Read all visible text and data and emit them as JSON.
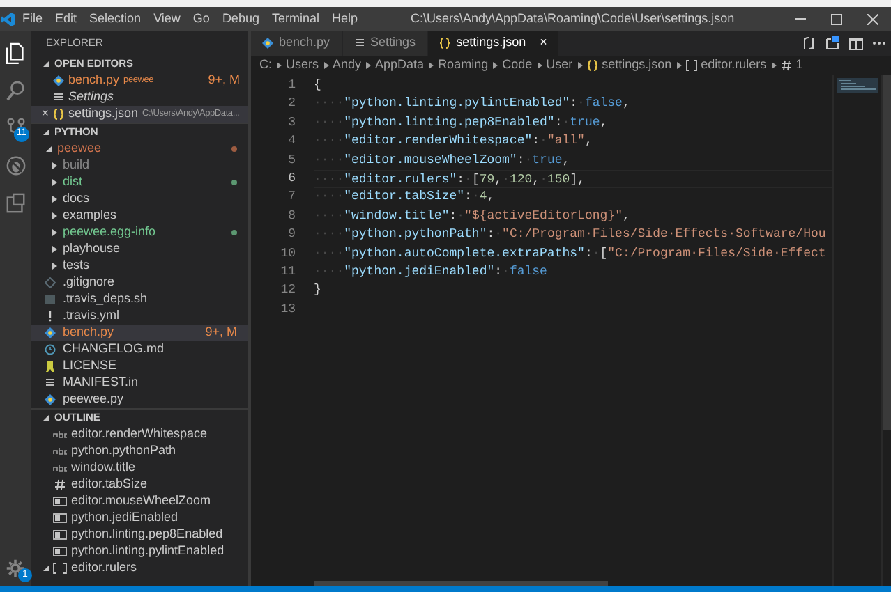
{
  "title_bar": {
    "menu": [
      "File",
      "Edit",
      "Selection",
      "View",
      "Go",
      "Debug",
      "Terminal",
      "Help"
    ],
    "title": "C:\\Users\\Andy\\AppData\\Roaming\\Code\\User\\settings.json"
  },
  "activity_bar": [
    {
      "kind": "files",
      "selected": true
    },
    {
      "kind": "search",
      "selected": false
    },
    {
      "kind": "source-control",
      "selected": false,
      "badge": "11"
    },
    {
      "kind": "debug",
      "selected": false
    },
    {
      "kind": "extensions",
      "selected": false
    }
  ],
  "manage": {
    "badge": "1"
  },
  "sidebar": {
    "title": "EXPLORER",
    "open_editors": {
      "title": "OPEN EDITORS",
      "expanded": true,
      "items": [
        {
          "label": "bench.py",
          "kind": "python",
          "description": "peewee",
          "status": "9+, M",
          "color": "#e8894a",
          "preview": false,
          "selected": false
        },
        {
          "label": "Settings",
          "kind": "list",
          "preview": true,
          "color": "#cccccc",
          "selected": false
        },
        {
          "label": "settings.json",
          "kind": "json",
          "description": "C:\\Users\\Andy\\AppData...",
          "close": "×",
          "color": "#cccccc",
          "preview": false,
          "selected": true
        }
      ]
    },
    "python": {
      "title": "PYTHON",
      "expanded": true,
      "tree": [
        {
          "label": "peewee",
          "kind": "folder",
          "expanded": true,
          "color": "#d0734d",
          "dot": true,
          "selected": false,
          "children": [
            {
              "label": "build",
              "kind": "folder",
              "expanded": false,
              "color": "#8b8b8b",
              "dot": false,
              "selected": false
            },
            {
              "label": "dist",
              "kind": "folder",
              "expanded": false,
              "color": "#73c991",
              "dot": true,
              "selected": false
            },
            {
              "label": "docs",
              "kind": "folder",
              "expanded": false,
              "color": "#cccccc",
              "dot": false,
              "selected": false
            },
            {
              "label": "examples",
              "kind": "folder",
              "expanded": false,
              "color": "#cccccc",
              "dot": false,
              "selected": false
            },
            {
              "label": "peewee.egg-info",
              "kind": "folder",
              "expanded": false,
              "color": "#73c991",
              "dot": true,
              "selected": false
            },
            {
              "label": "playhouse",
              "kind": "folder",
              "expanded": false,
              "color": "#cccccc",
              "dot": false,
              "selected": false
            },
            {
              "label": "tests",
              "kind": "folder",
              "expanded": false,
              "color": "#cccccc",
              "dot": false,
              "selected": false
            },
            {
              "label": ".gitignore",
              "kind": "git",
              "color": "#cccccc",
              "dot": false,
              "selected": false
            },
            {
              "label": ".travis_deps.sh",
              "kind": "shell",
              "color": "#cccccc",
              "dot": false,
              "selected": false
            },
            {
              "label": ".travis.yml",
              "kind": "yaml",
              "color": "#cccccc",
              "dot": false,
              "selected": false
            },
            {
              "label": "bench.py",
              "kind": "python",
              "color": "#e8894a",
              "status": "9+, M",
              "dot": false,
              "selected": true
            },
            {
              "label": "CHANGELOG.md",
              "kind": "changelog",
              "color": "#cccccc",
              "dot": false,
              "selected": false
            },
            {
              "label": "LICENSE",
              "kind": "license",
              "color": "#cccccc",
              "dot": false,
              "selected": false
            },
            {
              "label": "MANIFEST.in",
              "kind": "list",
              "color": "#cccccc",
              "dot": false,
              "selected": false
            },
            {
              "label": "peewee.py",
              "kind": "python",
              "color": "#cccccc",
              "dot": false,
              "selected": false
            }
          ]
        }
      ]
    },
    "outline": {
      "title": "OUTLINE",
      "expanded": true,
      "items": [
        {
          "label": "editor.renderWhitespace",
          "kind": "string"
        },
        {
          "label": "python.pythonPath",
          "kind": "string"
        },
        {
          "label": "window.title",
          "kind": "string"
        },
        {
          "label": "editor.tabSize",
          "kind": "number"
        },
        {
          "label": "editor.mouseWheelZoom",
          "kind": "boolean"
        },
        {
          "label": "python.jediEnabled",
          "kind": "boolean"
        },
        {
          "label": "python.linting.pep8Enabled",
          "kind": "boolean"
        },
        {
          "label": "python.linting.pylintEnabled",
          "kind": "boolean"
        },
        {
          "label": "editor.rulers",
          "kind": "array",
          "expanded": true
        }
      ]
    }
  },
  "tabs": [
    {
      "label": "bench.py",
      "kind": "python",
      "selected": false
    },
    {
      "label": "Settings",
      "kind": "list",
      "selected": false
    },
    {
      "label": "settings.json",
      "kind": "json",
      "selected": true,
      "close": "×"
    }
  ],
  "breadcrumbs": [
    {
      "label": "C:",
      "kind": "folder"
    },
    {
      "label": "Users",
      "kind": "folder"
    },
    {
      "label": "Andy",
      "kind": "folder"
    },
    {
      "label": "AppData",
      "kind": "folder"
    },
    {
      "label": "Roaming",
      "kind": "folder"
    },
    {
      "label": "Code",
      "kind": "folder"
    },
    {
      "label": "User",
      "kind": "folder"
    },
    {
      "label": "settings.json",
      "kind": "json"
    },
    {
      "label": "editor.rulers",
      "kind": "array"
    },
    {
      "label": "1",
      "kind": "number"
    }
  ],
  "editor": {
    "lines": [
      {
        "number": "1",
        "current": false,
        "tokens": [
          {
            "kind": "punct",
            "text": "{"
          }
        ]
      },
      {
        "number": "2",
        "current": false,
        "tokens": [
          {
            "kind": "ws",
            "text": "····"
          },
          {
            "kind": "key",
            "text": "\"python.linting.pylintEnabled\""
          },
          {
            "kind": "punct",
            "text": ":"
          },
          {
            "kind": "ws",
            "text": "·"
          },
          {
            "kind": "literal",
            "text": "false"
          },
          {
            "kind": "punct",
            "text": ","
          }
        ]
      },
      {
        "number": "3",
        "current": false,
        "tokens": [
          {
            "kind": "ws",
            "text": "····"
          },
          {
            "kind": "key",
            "text": "\"python.linting.pep8Enabled\""
          },
          {
            "kind": "punct",
            "text": ":"
          },
          {
            "kind": "ws",
            "text": "·"
          },
          {
            "kind": "literal",
            "text": "true"
          },
          {
            "kind": "punct",
            "text": ","
          }
        ]
      },
      {
        "number": "4",
        "current": false,
        "tokens": [
          {
            "kind": "ws",
            "text": "····"
          },
          {
            "kind": "key",
            "text": "\"editor.renderWhitespace\""
          },
          {
            "kind": "punct",
            "text": ":"
          },
          {
            "kind": "ws",
            "text": "·"
          },
          {
            "kind": "string",
            "text": "\"all\""
          },
          {
            "kind": "punct",
            "text": ","
          }
        ]
      },
      {
        "number": "5",
        "current": false,
        "tokens": [
          {
            "kind": "ws",
            "text": "····"
          },
          {
            "kind": "key",
            "text": "\"editor.mouseWheelZoom\""
          },
          {
            "kind": "punct",
            "text": ":"
          },
          {
            "kind": "ws",
            "text": "·"
          },
          {
            "kind": "literal",
            "text": "true"
          },
          {
            "kind": "punct",
            "text": ","
          }
        ]
      },
      {
        "number": "6",
        "current": true,
        "tokens": [
          {
            "kind": "ws",
            "text": "····"
          },
          {
            "kind": "key",
            "text": "\"editor.rulers\""
          },
          {
            "kind": "punct",
            "text": ":"
          },
          {
            "kind": "ws",
            "text": "·"
          },
          {
            "kind": "punct",
            "text": "["
          },
          {
            "kind": "number",
            "text": "79"
          },
          {
            "kind": "punct",
            "text": ","
          },
          {
            "kind": "ws",
            "text": "·"
          },
          {
            "kind": "number",
            "text": "120"
          },
          {
            "kind": "punct",
            "text": ","
          },
          {
            "kind": "ws",
            "text": "·"
          },
          {
            "kind": "number",
            "text": "150"
          },
          {
            "kind": "punct",
            "text": "],"
          }
        ]
      },
      {
        "number": "7",
        "current": false,
        "tokens": [
          {
            "kind": "ws",
            "text": "····"
          },
          {
            "kind": "key",
            "text": "\"editor.tabSize\""
          },
          {
            "kind": "punct",
            "text": ":"
          },
          {
            "kind": "ws",
            "text": "·"
          },
          {
            "kind": "number",
            "text": "4"
          },
          {
            "kind": "punct",
            "text": ","
          }
        ]
      },
      {
        "number": "8",
        "current": false,
        "tokens": [
          {
            "kind": "ws",
            "text": "····"
          },
          {
            "kind": "key",
            "text": "\"window.title\""
          },
          {
            "kind": "punct",
            "text": ":"
          },
          {
            "kind": "ws",
            "text": "·"
          },
          {
            "kind": "string",
            "text": "\"${activeEditorLong}\""
          },
          {
            "kind": "punct",
            "text": ","
          }
        ]
      },
      {
        "number": "9",
        "current": false,
        "tokens": [
          {
            "kind": "ws",
            "text": "····"
          },
          {
            "kind": "key",
            "text": "\"python.pythonPath\""
          },
          {
            "kind": "punct",
            "text": ":"
          },
          {
            "kind": "ws",
            "text": "·"
          },
          {
            "kind": "string",
            "text": "\"C:/Program·Files/Side·Effects·Software/Hou"
          }
        ]
      },
      {
        "number": "10",
        "current": false,
        "tokens": [
          {
            "kind": "ws",
            "text": "····"
          },
          {
            "kind": "key",
            "text": "\"python.autoComplete.extraPaths\""
          },
          {
            "kind": "punct",
            "text": ":"
          },
          {
            "kind": "ws",
            "text": "·"
          },
          {
            "kind": "punct",
            "text": "["
          },
          {
            "kind": "string",
            "text": "\"C:/Program·Files/Side·Effect"
          }
        ]
      },
      {
        "number": "11",
        "current": false,
        "tokens": [
          {
            "kind": "ws",
            "text": "····"
          },
          {
            "kind": "key",
            "text": "\"python.jediEnabled\""
          },
          {
            "kind": "punct",
            "text": ":"
          },
          {
            "kind": "ws",
            "text": "·"
          },
          {
            "kind": "literal",
            "text": "false"
          }
        ]
      },
      {
        "number": "12",
        "current": false,
        "tokens": [
          {
            "kind": "punct",
            "text": "}"
          }
        ]
      },
      {
        "number": "13",
        "current": false
      }
    ]
  }
}
